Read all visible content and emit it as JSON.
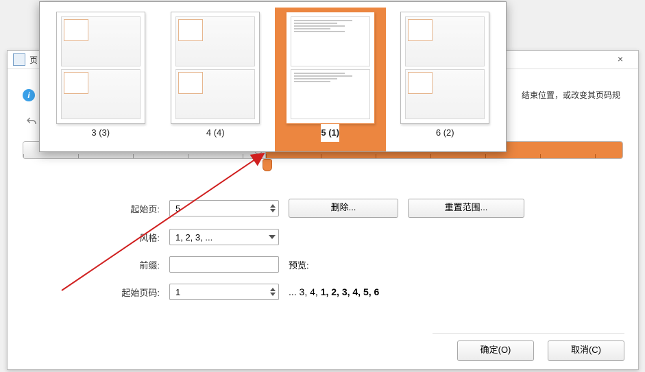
{
  "dialog": {
    "title": "页",
    "info_text": "结束位置，或改变其页码规",
    "close": "×"
  },
  "ruler": {
    "value": "5"
  },
  "form": {
    "start_page_label": "起始页:",
    "start_page_value": "5",
    "delete_btn": "删除...",
    "reset_btn": "重置范围...",
    "style_label": "风格:",
    "style_value": "1, 2, 3, ...",
    "prefix_label": "前缀:",
    "prefix_value": "",
    "start_num_label": "起始页码:",
    "start_num_value": "1",
    "preview_label": "预览:",
    "preview_prefix": "... 3, 4, ",
    "preview_bold": "1, 2, 3, 4, 5, 6"
  },
  "buttons": {
    "ok": "确定(O)",
    "cancel": "取消(C)"
  },
  "thumbs": [
    {
      "caption": "3 (3)",
      "selected": false,
      "style": "box"
    },
    {
      "caption": "4 (4)",
      "selected": false,
      "style": "box"
    },
    {
      "caption": "5 (1)",
      "selected": true,
      "style": "text"
    },
    {
      "caption": "6 (2)",
      "selected": false,
      "style": "box"
    }
  ]
}
